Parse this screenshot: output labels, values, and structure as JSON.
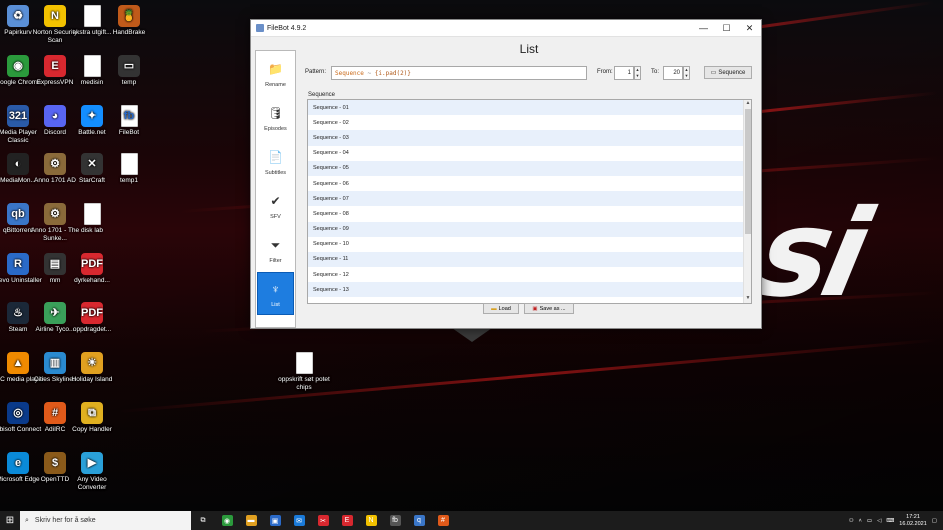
{
  "desktop": {
    "icons": [
      {
        "id": "recycle",
        "label": "Papirkurv",
        "glyph": "♻",
        "color": "#5a8fd6"
      },
      {
        "id": "norton",
        "label": "Norton Security Scan",
        "glyph": "N",
        "color": "#f2c100"
      },
      {
        "id": "ekstra",
        "label": "ekstra utgift...",
        "glyph": "",
        "color": "#ffffff"
      },
      {
        "id": "handbrake",
        "label": "HandBrake",
        "glyph": "🍍",
        "color": "#c05a1a"
      },
      {
        "id": "chrome",
        "label": "Google Chrome",
        "glyph": "◉",
        "color": "#2b9a3c"
      },
      {
        "id": "expressvpn",
        "label": "ExpressVPN",
        "glyph": "E",
        "color": "#d8282f"
      },
      {
        "id": "medisin",
        "label": "medisin",
        "glyph": "",
        "color": "#ffffff"
      },
      {
        "id": "temp",
        "label": "temp",
        "glyph": "▭",
        "color": "#333333"
      },
      {
        "id": "mpc",
        "label": "Media Player Classic",
        "glyph": "321",
        "color": "#2a5aa8"
      },
      {
        "id": "discord",
        "label": "Discord",
        "glyph": "◕",
        "color": "#5865f2"
      },
      {
        "id": "battlenet",
        "label": "Battle.net",
        "glyph": "✦",
        "color": "#148eff"
      },
      {
        "id": "filebot",
        "label": "FileBot",
        "glyph": "fb",
        "color": "#ffffff"
      },
      {
        "id": "mediamon",
        "label": "MediaMon...",
        "glyph": "◐",
        "color": "#222222"
      },
      {
        "id": "anno1701ad",
        "label": "Anno 1701 AD",
        "glyph": "⚙",
        "color": "#8a6a3a"
      },
      {
        "id": "starcraft",
        "label": "StarCraft",
        "glyph": "✕",
        "color": "#333333"
      },
      {
        "id": "temp1",
        "label": "temp1",
        "glyph": "",
        "color": "#ffffff"
      },
      {
        "id": "qbittorrent",
        "label": "qBittorrent",
        "glyph": "qb",
        "color": "#3a76c8"
      },
      {
        "id": "anno1701sunken",
        "label": "Anno 1701 - The Sunke...",
        "glyph": "⚙",
        "color": "#8a6a3a"
      },
      {
        "id": "disklab",
        "label": "disk lab",
        "glyph": "",
        "color": "#ffffff"
      },
      {
        "id": "revo",
        "label": "Revo Uninstaller",
        "glyph": "R",
        "color": "#2a6ac8"
      },
      {
        "id": "mm",
        "label": "mm",
        "glyph": "▤",
        "color": "#333333"
      },
      {
        "id": "dyrkehand",
        "label": "dyrkehand...",
        "glyph": "PDF",
        "color": "#d8282f"
      },
      {
        "id": "steam",
        "label": "Steam",
        "glyph": "♨",
        "color": "#1b2838"
      },
      {
        "id": "airline",
        "label": "Airline Tyco...",
        "glyph": "✈",
        "color": "#3aa05a"
      },
      {
        "id": "oppdrag",
        "label": "oppdragdet...",
        "glyph": "PDF",
        "color": "#d8282f"
      },
      {
        "id": "vlc",
        "label": "VLC media player",
        "glyph": "▲",
        "color": "#f08a00"
      },
      {
        "id": "cities",
        "label": "Cities Skylines",
        "glyph": "▥",
        "color": "#2a8ad0"
      },
      {
        "id": "holiday",
        "label": "Holiday Island",
        "glyph": "☀",
        "color": "#e0a020"
      },
      {
        "id": "ubisoft",
        "label": "Ubisoft Connect",
        "glyph": "◎",
        "color": "#0a3a8a"
      },
      {
        "id": "adirc",
        "label": "AdiIRC",
        "glyph": "#",
        "color": "#e05a1a"
      },
      {
        "id": "copyhandler",
        "label": "Copy Handler",
        "glyph": "⧉",
        "color": "#e0b020"
      },
      {
        "id": "edge",
        "label": "Microsoft Edge",
        "glyph": "e",
        "color": "#0a8ad8"
      },
      {
        "id": "openttd",
        "label": "OpenTTD",
        "glyph": "$",
        "color": "#8a5a1a"
      },
      {
        "id": "anyvideo",
        "label": "Any Video Converter",
        "glyph": "▶",
        "color": "#2aa0d8"
      },
      {
        "id": "oppskrift",
        "label": "oppskrift søt potet chips",
        "glyph": "",
        "color": "#ffffff"
      }
    ]
  },
  "window": {
    "title": "FileBot 4.9.2",
    "minimize": "—",
    "maximize": "☐",
    "close": "✕"
  },
  "sidebar": {
    "items": [
      {
        "label": "Rename",
        "glyph": "📁"
      },
      {
        "label": "Episodes",
        "glyph": "🛢"
      },
      {
        "label": "Subtitles",
        "glyph": "📄"
      },
      {
        "label": "SFV",
        "glyph": "✔"
      },
      {
        "label": "Filter",
        "glyph": "⏷"
      },
      {
        "label": "List",
        "glyph": "♆"
      }
    ],
    "active": "List"
  },
  "main": {
    "title": "List",
    "pattern_label": "Pattern:",
    "pattern_text_a": "Sequence",
    "pattern_text_b": "~",
    "pattern_text_c": "{i.pad(2)}",
    "from_label": "From:",
    "from_value": "1",
    "to_label": "To:",
    "to_value": "20",
    "sequence_button": "Sequence",
    "group_label": "Sequence",
    "rows": [
      "Sequence - 01",
      "Sequence - 02",
      "Sequence - 03",
      "Sequence - 04",
      "Sequence - 05",
      "Sequence - 06",
      "Sequence - 07",
      "Sequence - 08",
      "Sequence - 09",
      "Sequence - 10",
      "Sequence - 11",
      "Sequence - 12",
      "Sequence - 13"
    ],
    "load_button": "Load",
    "save_button": "Save as ..."
  },
  "taskbar": {
    "search_placeholder": "Skriv her for å søke",
    "time": "17:21",
    "date": "16.02.2021",
    "apps": [
      {
        "name": "task-view",
        "glyph": "⧉",
        "color": "#1c1c1c"
      },
      {
        "name": "chrome",
        "glyph": "◉",
        "color": "#2b9a3c"
      },
      {
        "name": "explorer",
        "glyph": "▬",
        "color": "#e0a020"
      },
      {
        "name": "store",
        "glyph": "▣",
        "color": "#2a6ac8"
      },
      {
        "name": "mail",
        "glyph": "✉",
        "color": "#1a7ad8"
      },
      {
        "name": "snip",
        "glyph": "✂",
        "color": "#d8282f"
      },
      {
        "name": "expressvpn",
        "glyph": "E",
        "color": "#d8282f"
      },
      {
        "name": "norton",
        "glyph": "N",
        "color": "#f2c100"
      },
      {
        "name": "filebot",
        "glyph": "fb",
        "color": "#555555"
      },
      {
        "name": "qbittorrent",
        "glyph": "q",
        "color": "#3a76c8"
      },
      {
        "name": "adirc",
        "glyph": "#",
        "color": "#e05a1a"
      }
    ]
  }
}
